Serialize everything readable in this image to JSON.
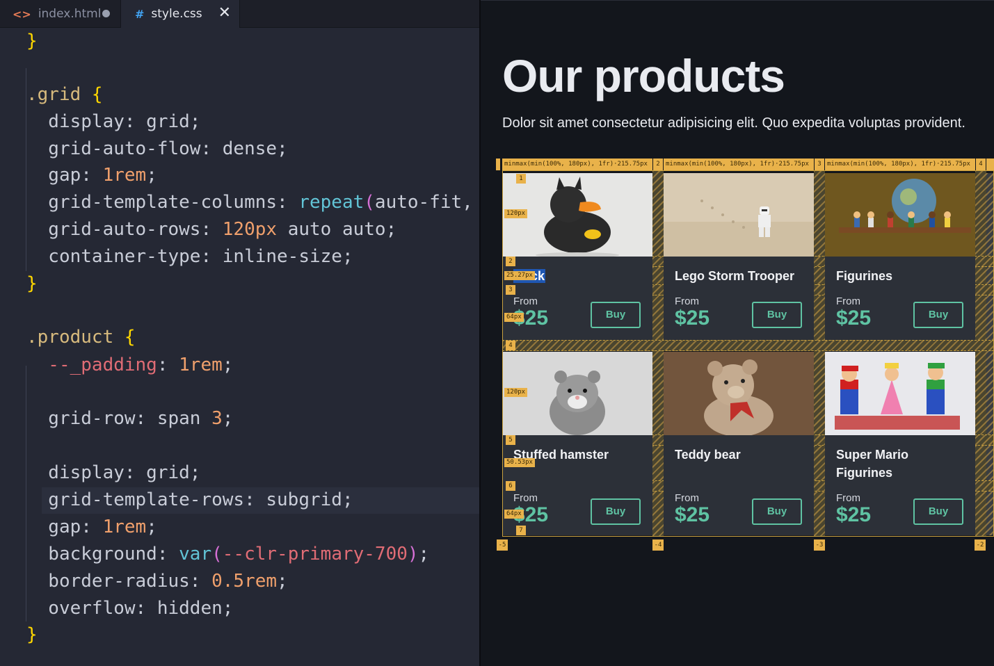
{
  "editor": {
    "tabs": [
      {
        "label": "index.html",
        "icon": "<>",
        "state": "modified"
      },
      {
        "label": "style.css",
        "icon": "#",
        "state": "active"
      }
    ],
    "code_lines": [
      [
        {
          "t": "}",
          "c": "brace"
        }
      ],
      [],
      [
        {
          "t": ".grid ",
          "c": "sel"
        },
        {
          "t": "{",
          "c": "brace"
        }
      ],
      [
        {
          "t": "  display: grid;",
          "c": "prop"
        }
      ],
      [
        {
          "t": "  grid-auto-flow: dense;",
          "c": "prop"
        }
      ],
      [
        {
          "t": "  gap: ",
          "c": "prop"
        },
        {
          "t": "1rem",
          "c": "num"
        },
        {
          "t": ";",
          "c": "punc"
        }
      ],
      [
        {
          "t": "  grid-template-columns: ",
          "c": "prop"
        },
        {
          "t": "repeat",
          "c": "fn"
        },
        {
          "t": "(",
          "c": "paren"
        },
        {
          "t": "auto-fit,",
          "c": "prop"
        }
      ],
      [
        {
          "t": "  grid-auto-rows: ",
          "c": "prop"
        },
        {
          "t": "120px",
          "c": "num"
        },
        {
          "t": " auto auto;",
          "c": "prop"
        }
      ],
      [
        {
          "t": "  container-type: inline-size;",
          "c": "prop"
        }
      ],
      [
        {
          "t": "}",
          "c": "brace"
        }
      ],
      [],
      [
        {
          "t": ".product ",
          "c": "sel"
        },
        {
          "t": "{",
          "c": "brace"
        }
      ],
      [
        {
          "t": "  --_padding",
          "c": "var"
        },
        {
          "t": ": ",
          "c": "punc"
        },
        {
          "t": "1rem",
          "c": "num"
        },
        {
          "t": ";",
          "c": "punc"
        }
      ],
      [],
      [
        {
          "t": "  grid-row: span ",
          "c": "prop"
        },
        {
          "t": "3",
          "c": "num"
        },
        {
          "t": ";",
          "c": "punc"
        }
      ],
      [],
      [
        {
          "t": "  display: grid;",
          "c": "prop"
        }
      ],
      [
        {
          "t": "  grid-template-rows: subgrid;",
          "c": "prop"
        }
      ],
      [
        {
          "t": "  gap: ",
          "c": "prop"
        },
        {
          "t": "1rem",
          "c": "num"
        },
        {
          "t": ";",
          "c": "punc"
        }
      ],
      [
        {
          "t": "  background: ",
          "c": "prop"
        },
        {
          "t": "var",
          "c": "fn"
        },
        {
          "t": "(",
          "c": "paren"
        },
        {
          "t": "--clr-primary-700",
          "c": "var"
        },
        {
          "t": ")",
          "c": "paren"
        },
        {
          "t": ";",
          "c": "punc"
        }
      ],
      [
        {
          "t": "  border-radius: ",
          "c": "prop"
        },
        {
          "t": "0.5rem",
          "c": "num"
        },
        {
          "t": ";",
          "c": "punc"
        }
      ],
      [
        {
          "t": "  overflow: hidden;",
          "c": "prop"
        }
      ],
      [
        {
          "t": "}",
          "c": "brace"
        }
      ]
    ]
  },
  "preview": {
    "title": "Our products",
    "subtitle": "Dolor sit amet consectetur adipisicing elit. Quo expedita voluptas provident.",
    "grid_overlay": {
      "column_track_label": "minmax(min(100%, 180px), 1fr)·215.75px",
      "column_line_numbers": [
        "1",
        "2",
        "3",
        "4"
      ],
      "row_line_numbers": [
        "1",
        "2",
        "3",
        "4",
        "5",
        "6",
        "7"
      ],
      "track_sizes": [
        "120px",
        "25.27px",
        "64px",
        "120px",
        "50.53px",
        "64px"
      ],
      "negative_line_numbers": [
        "-5",
        "-4",
        "-3",
        "-2"
      ]
    },
    "products": [
      {
        "name": "Duck",
        "from_label": "From",
        "price": "$25",
        "buy_label": "Buy",
        "image": "rubber-duck-batman",
        "selected": true
      },
      {
        "name": "Lego Storm Trooper",
        "from_label": "From",
        "price": "$25",
        "buy_label": "Buy",
        "image": "lego-storm-trooper"
      },
      {
        "name": "Figurines",
        "from_label": "From",
        "price": "$25",
        "buy_label": "Buy",
        "image": "figurines-globe-shelf"
      },
      {
        "name": "Stuffed hamster",
        "from_label": "From",
        "price": "$25",
        "buy_label": "Buy",
        "image": "stuffed-hamster"
      },
      {
        "name": "Teddy bear",
        "from_label": "From",
        "price": "$25",
        "buy_label": "Buy",
        "image": "teddy-bear"
      },
      {
        "name": "Super Mario Figurines",
        "from_label": "From",
        "price": "$25",
        "buy_label": "Buy",
        "image": "super-mario-figurines"
      }
    ],
    "colors": {
      "accent": "#5fc3a3",
      "card_bg": "#2c3038",
      "overlay": "#e9b24a",
      "page_bg": "#13161c"
    }
  }
}
